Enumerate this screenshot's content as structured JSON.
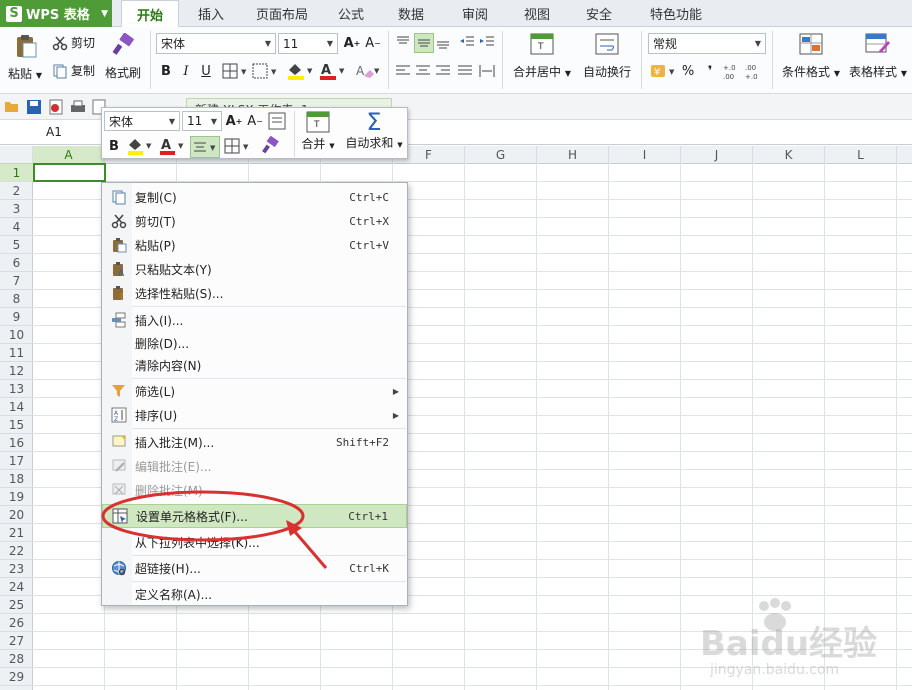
{
  "app": {
    "logo_letter": "S",
    "name": "WPS 表格"
  },
  "tabs": [
    "开始",
    "插入",
    "页面布局",
    "公式",
    "数据",
    "审阅",
    "视图",
    "安全",
    "特色功能"
  ],
  "ribbon": {
    "paste": "粘贴",
    "cut": "剪切",
    "copy": "复制",
    "format_painter": "格式刷",
    "font_name": "宋体",
    "font_size": "11",
    "merge_center": "合并居中",
    "wrap_text": "自动换行",
    "number_format": "常规",
    "percent": "%",
    "comma": "❜",
    "conditional_format": "条件格式",
    "table_style": "表格样式"
  },
  "doc_tab": "新建 XLSX 工作表 .1",
  "name_box": "A1",
  "columns": [
    "A",
    "B",
    "C",
    "D",
    "E",
    "F",
    "G",
    "H",
    "I",
    "J",
    "K",
    "L"
  ],
  "rows": [
    "1",
    "2",
    "3",
    "4",
    "5",
    "6",
    "7",
    "8",
    "9",
    "10",
    "11",
    "12",
    "13",
    "14",
    "15",
    "16",
    "17",
    "18",
    "19",
    "20",
    "21",
    "22",
    "23",
    "24",
    "25",
    "26",
    "27",
    "28",
    "29"
  ],
  "mini_toolbar": {
    "font_name": "宋体",
    "font_size": "11",
    "merge": "合并",
    "autosum": "自动求和"
  },
  "context_menu": [
    {
      "label": "复制(C)",
      "shortcut": "Ctrl+C",
      "icon": "copy-icon"
    },
    {
      "label": "剪切(T)",
      "shortcut": "Ctrl+X",
      "icon": "scissors-icon"
    },
    {
      "label": "粘贴(P)",
      "shortcut": "Ctrl+V",
      "icon": "paste-icon"
    },
    {
      "label": "只粘贴文本(Y)",
      "shortcut": "",
      "icon": "paste-text-icon"
    },
    {
      "label": "选择性粘贴(S)...",
      "shortcut": "",
      "icon": "paste-special-icon"
    },
    {
      "label": "插入(I)...",
      "shortcut": "",
      "icon": "insert-icon"
    },
    {
      "label": "删除(D)...",
      "shortcut": "",
      "icon": ""
    },
    {
      "label": "清除内容(N)",
      "shortcut": "",
      "icon": ""
    },
    {
      "label": "筛选(L)",
      "shortcut": "",
      "icon": "filter-icon"
    },
    {
      "label": "排序(U)",
      "shortcut": "",
      "icon": "sort-icon"
    },
    {
      "label": "插入批注(M)...",
      "shortcut": "Shift+F2",
      "icon": "insert-comment-icon"
    },
    {
      "label": "编辑批注(E)...",
      "shortcut": "",
      "icon": "edit-comment-icon"
    },
    {
      "label": "删除批注(M)",
      "shortcut": "",
      "icon": "delete-comment-icon"
    },
    {
      "label": "设置单元格格式(F)...",
      "shortcut": "Ctrl+1",
      "icon": "format-cells-icon"
    },
    {
      "label": "从下拉列表中选择(K)...",
      "shortcut": "",
      "icon": ""
    },
    {
      "label": "超链接(H)...",
      "shortcut": "Ctrl+K",
      "icon": "hyperlink-icon"
    },
    {
      "label": "定义名称(A)...",
      "shortcut": "",
      "icon": ""
    }
  ],
  "watermark": {
    "brand": "Baidu经验",
    "url": "jingyan.baidu.com"
  },
  "colors": {
    "brand_green": "#4e9b38",
    "annotation_red": "#d93030",
    "menu_highlight": "#cfe8c1"
  }
}
